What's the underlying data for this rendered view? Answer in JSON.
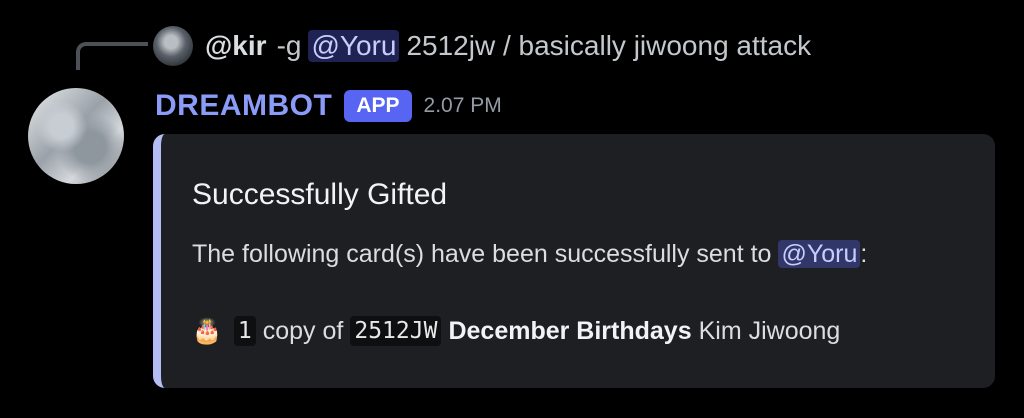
{
  "reply": {
    "author": "@kir",
    "command": "-g",
    "mention": "@Yoru",
    "text": "2512jw / basically jiwoong attack"
  },
  "message": {
    "bot_name": "DREAMBOT",
    "badge": "APP",
    "timestamp": "2.07 PM"
  },
  "embed": {
    "accent_color": "#b5bdf5",
    "title": "Successfully Gifted",
    "description_prefix": "The following card(s) have been successfully sent to",
    "description_mention": "@Yoru",
    "description_suffix": ":",
    "card": {
      "icon": "birthday-cake-icon",
      "icon_glyph": "🎂",
      "count": "1",
      "copy_text": "copy of",
      "code": "2512JW",
      "set_name": "December Birthdays",
      "member": "Kim Jiwoong"
    }
  },
  "colors": {
    "background": "#000000",
    "bot_name": "#8b9cf8",
    "badge": "#5865f2",
    "embed_bg": "#1e1f22"
  }
}
